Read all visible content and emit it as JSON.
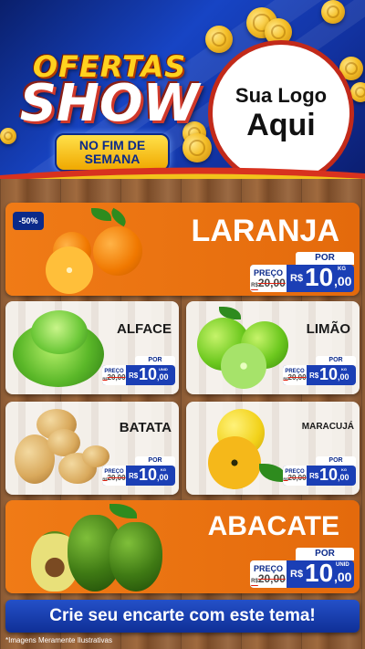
{
  "header": {
    "brand_line1": "OFERTAS",
    "brand_line2": "SHOW",
    "badge_line1": "NO FIM DE",
    "badge_line2": "SEMANA",
    "logo_line1": "Sua Logo",
    "logo_line2": "Aqui"
  },
  "colors": {
    "header_blue": "#1744c4",
    "card_orange": "#f07b16",
    "price_blue": "#1b3fb5",
    "coin_gold": "#f5c02a"
  },
  "products": [
    {
      "name": "LARANJA",
      "discount": "-50%",
      "por_label": "POR",
      "preco_label": "PREÇO",
      "old_price": "20,00",
      "old_prefix": "R$",
      "currency": "R$",
      "price_int": "10",
      "price_dec": ",00",
      "unit": "KG",
      "icon": "orange-icon"
    },
    {
      "name": "ALFACE",
      "por_label": "POR",
      "preco_label": "PREÇO",
      "old_price": "20,00",
      "old_prefix": "R$",
      "currency": "R$",
      "price_int": "10",
      "price_dec": ",00",
      "unit": "UNID",
      "icon": "lettuce-icon"
    },
    {
      "name": "LIMÃO",
      "por_label": "POR",
      "preco_label": "PREÇO",
      "old_price": "20,00",
      "old_prefix": "R$",
      "currency": "R$",
      "price_int": "10",
      "price_dec": ",00",
      "unit": "KG",
      "icon": "lime-icon"
    },
    {
      "name": "BATATA",
      "por_label": "POR",
      "preco_label": "PREÇO",
      "old_price": "20,00",
      "old_prefix": "R$",
      "currency": "R$",
      "price_int": "10",
      "price_dec": ",00",
      "unit": "KG",
      "icon": "potato-icon"
    },
    {
      "name": "MARACUJÁ",
      "por_label": "POR",
      "preco_label": "PREÇO",
      "old_price": "20,00",
      "old_prefix": "R$",
      "currency": "R$",
      "price_int": "10",
      "price_dec": ",00",
      "unit": "KG",
      "icon": "passion-fruit-icon"
    },
    {
      "name": "ABACATE",
      "por_label": "POR",
      "preco_label": "PREÇO",
      "old_price": "20,00",
      "old_prefix": "R$",
      "currency": "R$",
      "price_int": "10",
      "price_dec": ",00",
      "unit": "UNID",
      "icon": "avocado-icon"
    }
  ],
  "footer": {
    "cta": "Crie seu encarte com este tema!",
    "disclaimer": "*Imagens Meramente Ilustrativas"
  }
}
